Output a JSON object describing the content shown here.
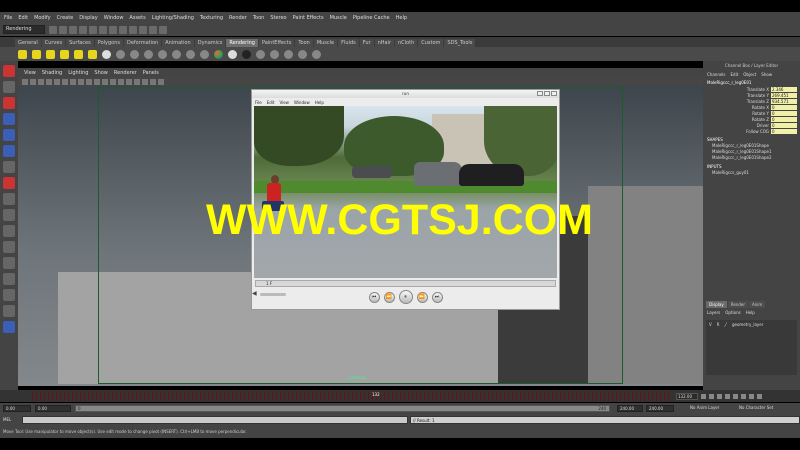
{
  "menubar": [
    "File",
    "Edit",
    "Modify",
    "Create",
    "Display",
    "Window",
    "Assets",
    "Lighting/Shading",
    "Texturing",
    "Render",
    "Toon",
    "Stereo",
    "Paint Effects",
    "Muscle",
    "Pipeline Cache",
    "Help"
  ],
  "status": {
    "mode": "Rendering"
  },
  "shelf_tabs": [
    "General",
    "Curves",
    "Surfaces",
    "Polygons",
    "Deformation",
    "Animation",
    "Dynamics",
    "Rendering",
    "PaintEffects",
    "Toon",
    "Muscle",
    "Fluids",
    "Fur",
    "nHair",
    "nCloth",
    "Custom",
    "SDS_Tools"
  ],
  "shelf_active": "Rendering",
  "viewport": {
    "menu": [
      "View",
      "Shading",
      "Lighting",
      "Show",
      "Renderer",
      "Panels"
    ],
    "camera_label": "camera1"
  },
  "player": {
    "title": "run",
    "menu": [
      "File",
      "Edit",
      "View",
      "Window",
      "Help"
    ],
    "frame_label": "1 F",
    "buttons": {
      "prev": "⏮",
      "rew": "⏪",
      "play": "⏸",
      "ff": "⏩",
      "next": "⏭"
    }
  },
  "watermark": "WWW.CGTSJ.COM",
  "channel_box": {
    "title": "Channel Box / Layer Editor",
    "menu": [
      "Channels",
      "Edit",
      "Object",
      "Show"
    ],
    "object": "MaleRigccc_r_leg0E01",
    "attributes": [
      {
        "label": "Translate X",
        "value": "2.346"
      },
      {
        "label": "Translate Y",
        "value": "269.451"
      },
      {
        "label": "Translate Z",
        "value": "934.571"
      },
      {
        "label": "Rotate X",
        "value": "0"
      },
      {
        "label": "Rotate Y",
        "value": "0"
      },
      {
        "label": "Rotate Z",
        "value": "0"
      },
      {
        "label": "Driver",
        "value": "0"
      },
      {
        "label": "Follow COG",
        "value": "0"
      }
    ],
    "shapes_header": "SHAPES",
    "shapes": [
      "MaleRigccc_r_leg0E01Shape",
      "MaleRigccc_r_leg0E01Shape1",
      "MaleRigccc_r_leg0E01Shape2"
    ],
    "inputs_header": "INPUTS",
    "inputs": [
      "MaleRigccs_guy01"
    ]
  },
  "layer_editor": {
    "tabs": [
      "Display",
      "Render",
      "Anim"
    ],
    "menu": [
      "Layers",
      "Options",
      "Help"
    ],
    "layer": {
      "v": "V",
      "r": "R",
      "name": "geometry_layer"
    }
  },
  "timeline": {
    "current": "132",
    "current_field": "132.00"
  },
  "range": {
    "start": "0.00",
    "start2": "0.00",
    "bar_start": "0",
    "bar_end": "240",
    "end": "240.00",
    "end2": "240.00",
    "anim_layer": "No Anim Layer",
    "char_set": "No Character Set"
  },
  "cmdline": {
    "label": "MEL",
    "result": "// Result: 1"
  },
  "helpline": "Move Tool: Use manipulator to move object(s). Use edit mode to change pivot (INSERT). Ctrl+LMB to move perpendicular."
}
